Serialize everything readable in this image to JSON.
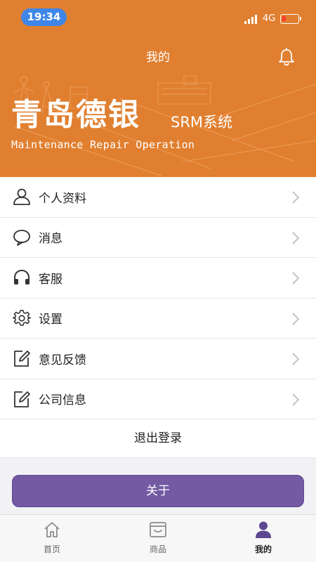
{
  "status_bar": {
    "time": "19:34",
    "network": "4G"
  },
  "header": {
    "title": "我的",
    "brand_cn": "青岛德银",
    "brand_srm": "SRM系统",
    "brand_en": "Maintenance Repair Operation"
  },
  "menu": [
    {
      "label": "个人资料",
      "icon": "user-icon"
    },
    {
      "label": "消息",
      "icon": "chat-bubble-icon"
    },
    {
      "label": "客服",
      "icon": "headphones-icon"
    },
    {
      "label": "设置",
      "icon": "gear-icon"
    },
    {
      "label": "意见反馈",
      "icon": "edit-icon"
    },
    {
      "label": "公司信息",
      "icon": "edit-icon"
    }
  ],
  "logout_label": "退出登录",
  "about_label": "关于",
  "tabbar": [
    {
      "label": "首页",
      "icon": "home-icon"
    },
    {
      "label": "商品",
      "icon": "shop-icon"
    },
    {
      "label": "我的",
      "icon": "person-icon",
      "active": true
    }
  ],
  "colors": {
    "header": "#e07f2f",
    "accent": "#735aa2",
    "time_pill": "#3f86e8"
  }
}
